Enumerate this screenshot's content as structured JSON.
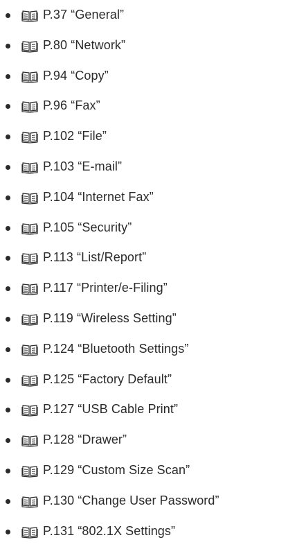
{
  "references": [
    {
      "page": "P.37",
      "title": "“General”"
    },
    {
      "page": "P.80",
      "title": "“Network”"
    },
    {
      "page": "P.94",
      "title": "“Copy”"
    },
    {
      "page": "P.96",
      "title": "“Fax”"
    },
    {
      "page": "P.102",
      "title": "“File”"
    },
    {
      "page": "P.103",
      "title": "“E-mail”"
    },
    {
      "page": "P.104",
      "title": "“Internet Fax”"
    },
    {
      "page": "P.105",
      "title": "“Security”"
    },
    {
      "page": "P.113",
      "title": "“List/Report”"
    },
    {
      "page": "P.117",
      "title": "“Printer/e-Filing”"
    },
    {
      "page": "P.119",
      "title": "“Wireless Setting”"
    },
    {
      "page": "P.124",
      "title": "“Bluetooth Settings”"
    },
    {
      "page": "P.125",
      "title": "“Factory Default”"
    },
    {
      "page": "P.127",
      "title": "“USB Cable Print”"
    },
    {
      "page": "P.128",
      "title": "“Drawer”"
    },
    {
      "page": "P.129",
      "title": "“Custom Size Scan”"
    },
    {
      "page": "P.130",
      "title": "“Change User Password”"
    },
    {
      "page": "P.131",
      "title": "“802.1X Settings”"
    }
  ]
}
